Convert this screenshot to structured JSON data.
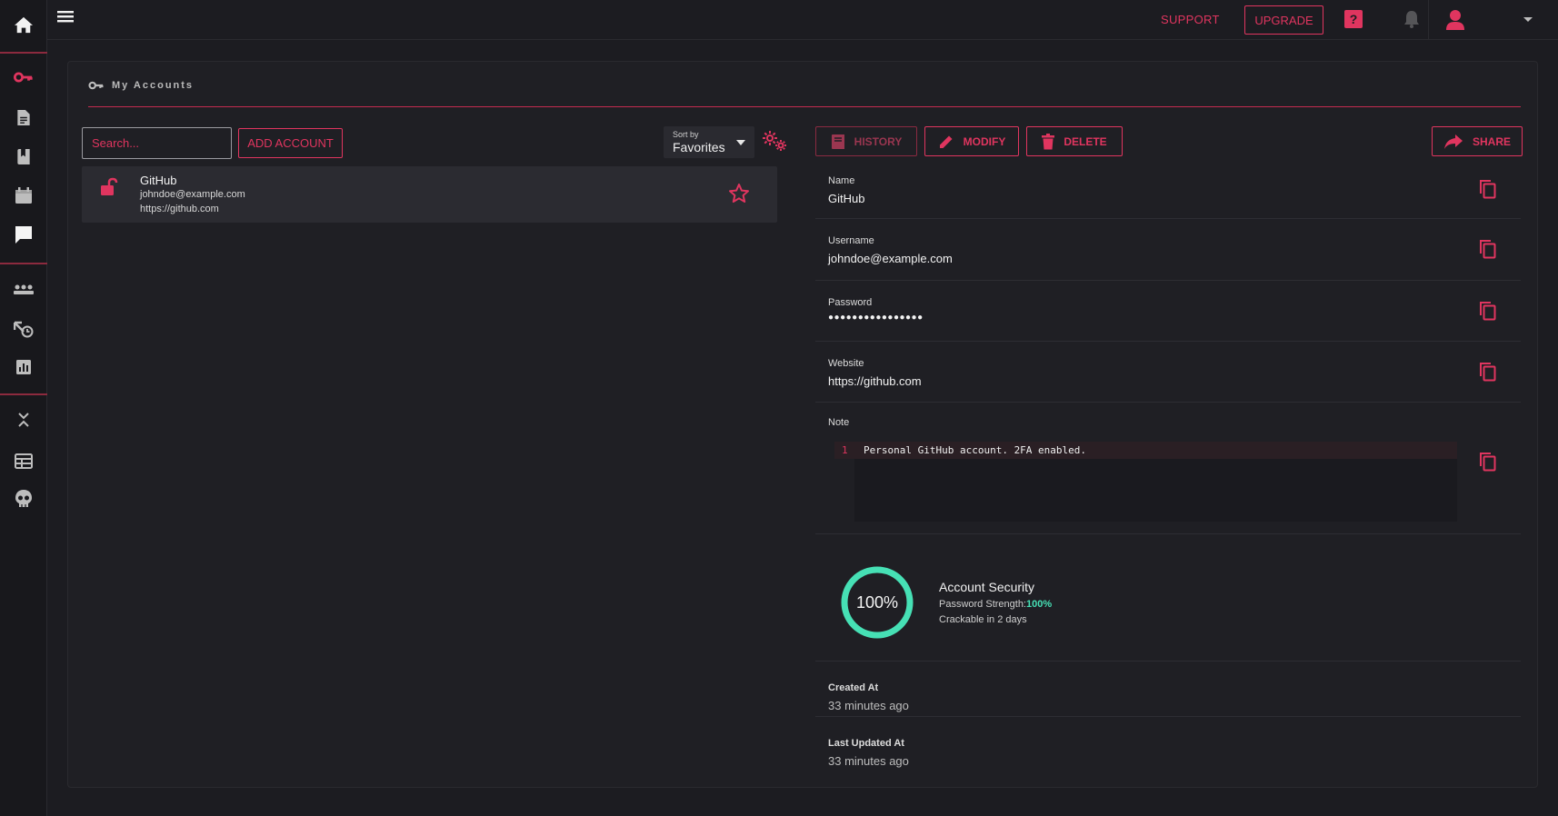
{
  "header": {
    "support_label": "SUPPORT",
    "upgrade_label": "UPGRADE"
  },
  "page": {
    "title": "My Accounts"
  },
  "toolbar": {
    "search_placeholder": "Search...",
    "add_account_label": "ADD ACCOUNT",
    "sort_label": "Sort by",
    "sort_value": "Favorites"
  },
  "accounts": [
    {
      "name": "GitHub",
      "username": "johndoe@example.com",
      "website": "https://github.com",
      "favorite": false
    }
  ],
  "detail_actions": {
    "history_label": "HISTORY",
    "modify_label": "MODIFY",
    "delete_label": "DELETE",
    "share_label": "SHARE"
  },
  "detail": {
    "name_label": "Name",
    "name_value": "GitHub",
    "username_label": "Username",
    "username_value": "johndoe@example.com",
    "password_label": "Password",
    "password_value": "●●●●●●●●●●●●●●●●",
    "website_label": "Website",
    "website_value": "https://github.com",
    "note_label": "Note",
    "note_line_number": "1",
    "note_text": "Personal GitHub account. 2FA enabled."
  },
  "security": {
    "score_text": "100%",
    "score_fraction": 1.0,
    "title": "Account Security",
    "strength_label": "Password Strength:",
    "strength_value": "100%",
    "crackable_text": "Crackable in 2 days"
  },
  "meta": {
    "created_label": "Created At",
    "created_value": "33 minutes ago",
    "updated_label": "Last Updated At",
    "updated_value": "33 minutes ago"
  },
  "colors": {
    "accent": "#e0355f",
    "success": "#46e0b5",
    "background": "#1c1c21"
  },
  "icons": {
    "sidebar": [
      "home-icon",
      "key-icon",
      "document-icon",
      "book-icon",
      "calendar-icon",
      "chat-icon",
      "group-icon",
      "history-icon",
      "chart-icon",
      "collapse-icon",
      "table-icon",
      "skull-icon"
    ]
  }
}
